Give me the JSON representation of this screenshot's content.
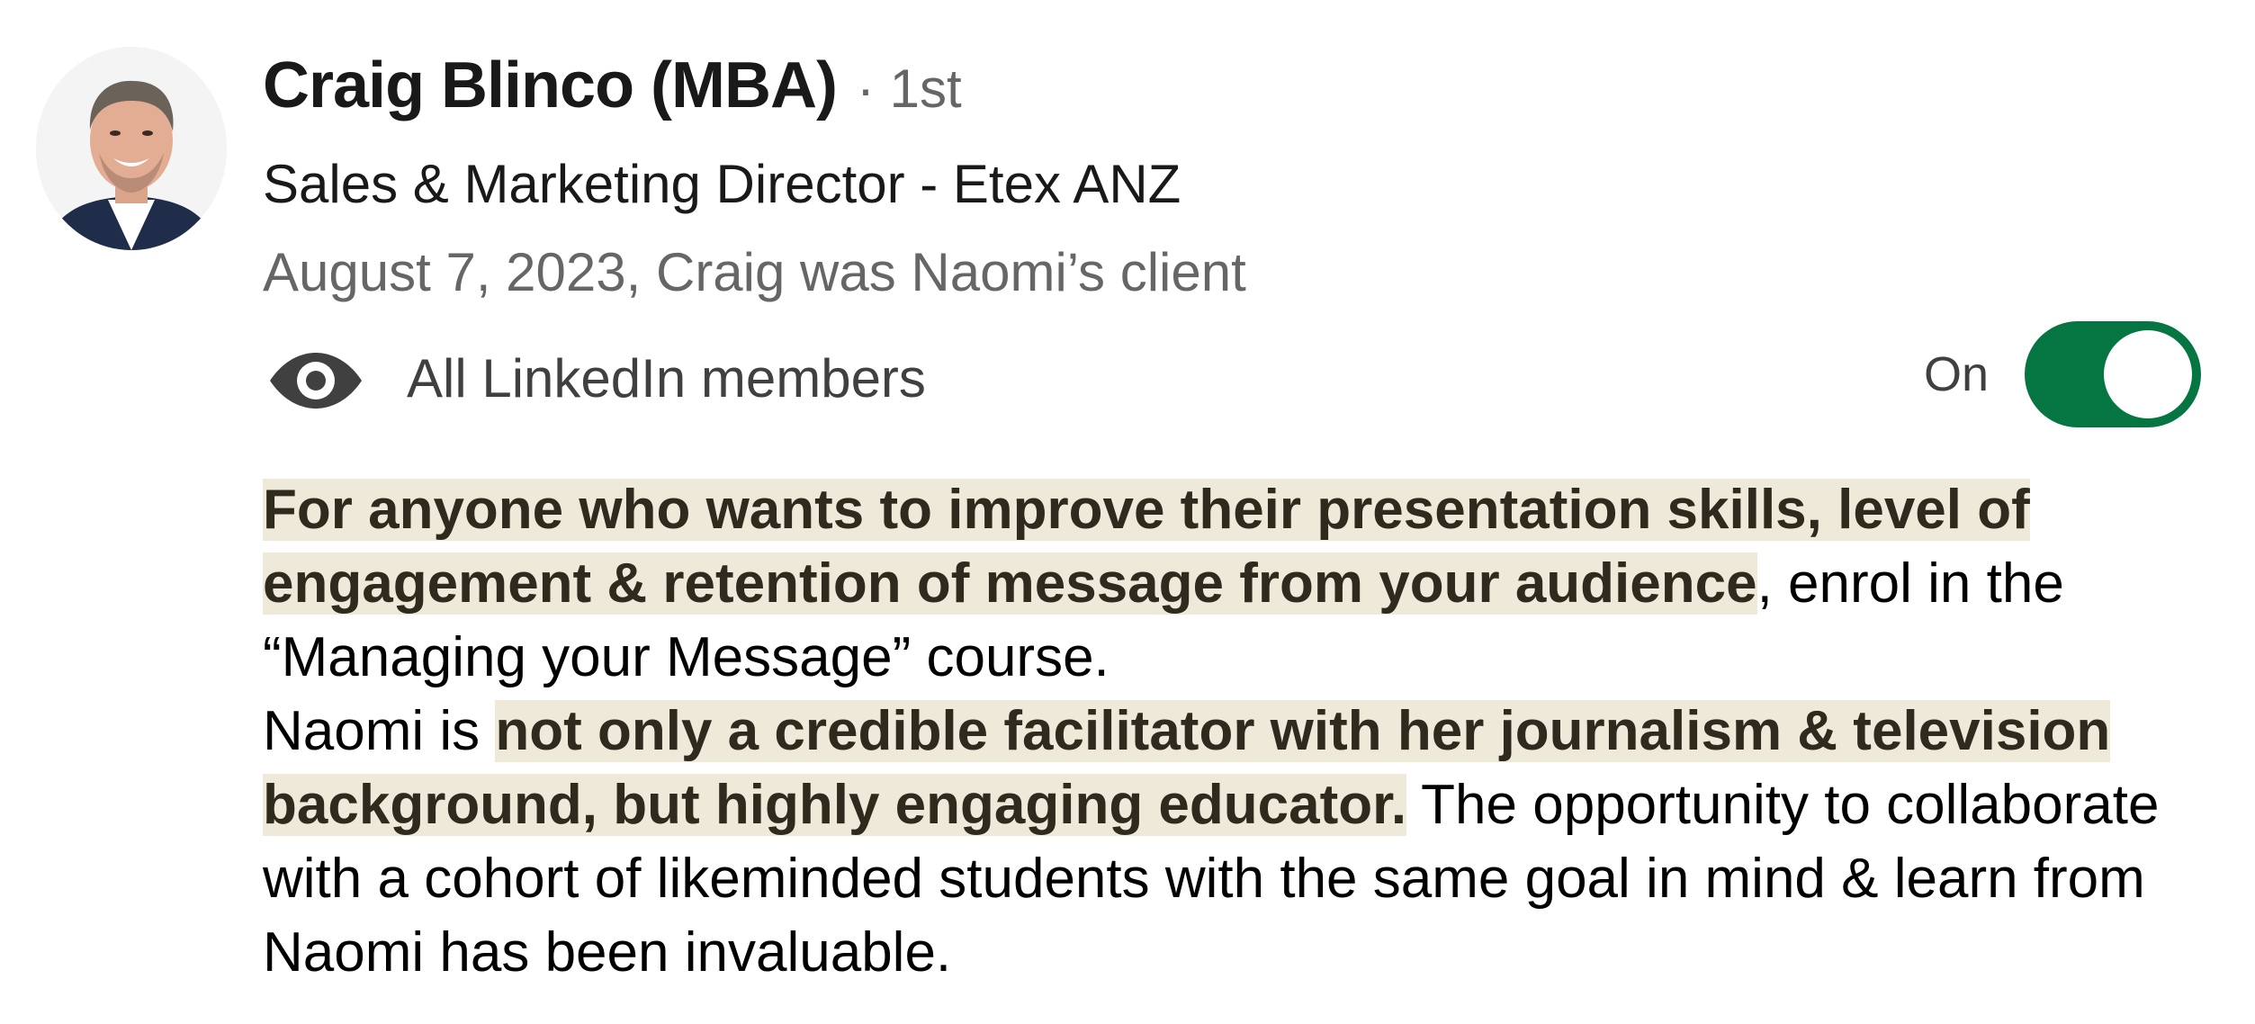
{
  "profile": {
    "name": "Craig Blinco (MBA)",
    "degree": "· 1st",
    "headline": "Sales & Marketing Director - Etex ANZ",
    "meta": "August 7, 2023, Craig was Naomi’s client"
  },
  "visibility": {
    "label": "All LinkedIn members",
    "toggle_state": "On",
    "toggle_on": true,
    "accent_color": "#057642"
  },
  "recommendation": {
    "p1_highlight": "For anyone who wants to improve their presentation skills, level of engagement & retention of message from your audience",
    "p1_rest": ", enrol in the “Managing your Message” course.",
    "p2_prefix": "Naomi is ",
    "p2_highlight": "not only a credible facilitator with her journalism & television background, but highly engaging educator.",
    "p2_rest": " The opportunity to collaborate with a cohort of likeminded students with the same goal in mind & learn from Naomi has been invaluable.",
    "highlight_color": "#efe9d9"
  },
  "icons": {
    "avatar": "profile-photo",
    "visibility": "eye-icon"
  }
}
